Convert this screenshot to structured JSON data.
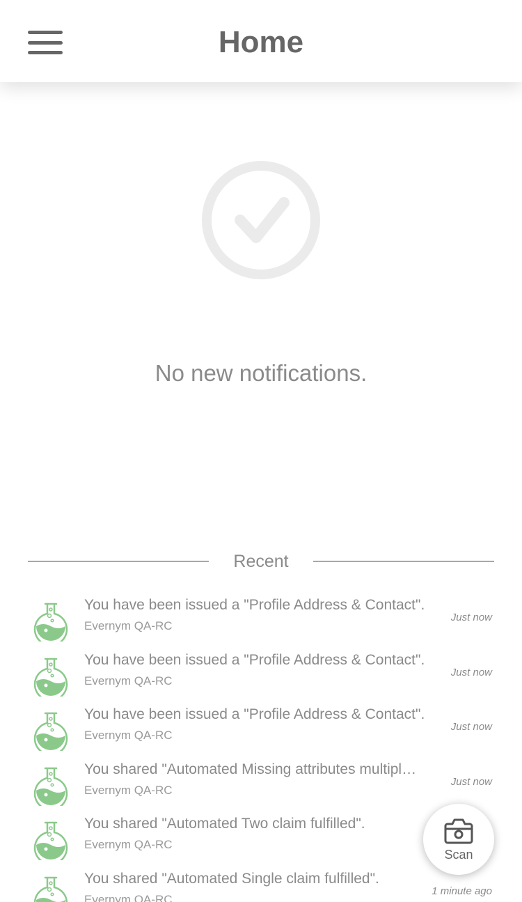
{
  "header": {
    "title": "Home",
    "menu_icon": "hamburger-menu-icon"
  },
  "empty_state": {
    "icon": "checkmark-circle-icon",
    "message": "No new notifications."
  },
  "recent": {
    "label": "Recent",
    "items": [
      {
        "title": "You have been issued a \"Profile Address & Contact\".",
        "subtitle": "Evernym QA-RC",
        "time": "Just now",
        "icon": "flask-icon"
      },
      {
        "title": "You have been issued a \"Profile Address & Contact\".",
        "subtitle": "Evernym QA-RC",
        "time": "Just now",
        "icon": "flask-icon"
      },
      {
        "title": "You have been issued a \"Profile Address & Contact\".",
        "subtitle": "Evernym QA-RC",
        "time": "Just now",
        "icon": "flask-icon"
      },
      {
        "title": "You shared \"Automated Missing attributes multipl…",
        "subtitle": "Evernym QA-RC",
        "time": "Just now",
        "icon": "flask-icon"
      },
      {
        "title": "You shared \"Automated Two claim fulfilled\".",
        "subtitle": "Evernym QA-RC",
        "time": "",
        "icon": "flask-icon"
      },
      {
        "title": "You shared \"Automated Single claim fulfilled\".",
        "subtitle": "Evernym QA-RC",
        "time": "1 minute ago",
        "icon": "flask-icon"
      }
    ]
  },
  "scan_button": {
    "label": "Scan",
    "icon": "camera-icon"
  },
  "colors": {
    "text_gray": "#8a8a8a",
    "header_gray": "#666666",
    "flask_green": "#8bc98b",
    "icon_light_gray": "#ebebeb"
  }
}
